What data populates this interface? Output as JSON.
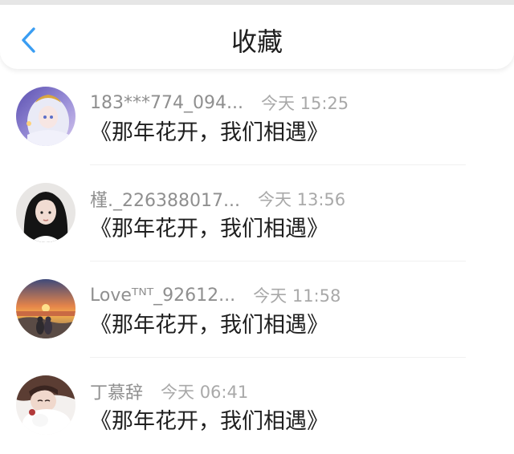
{
  "header": {
    "title": "收藏",
    "back_icon": "chevron-left-icon",
    "accent_color": "#3a9df2"
  },
  "favorites": [
    {
      "username": "183***774_094...",
      "time": "今天 15:25",
      "message": "《那年花开，我们相遇》",
      "avatar": "anime-character-avatar"
    },
    {
      "username": "槿._226388017...",
      "time": "今天 13:56",
      "message": "《那年花开，我们相遇》",
      "avatar": "girl-portrait-avatar"
    },
    {
      "username": "Loveᵀᴺᵀ_92612...",
      "time": "今天 11:58",
      "message": "《那年花开，我们相遇》",
      "avatar": "sunset-beach-avatar"
    },
    {
      "username": "丁慕辞",
      "time": "今天 06:41",
      "message": "《那年花开，我们相遇》",
      "avatar": "girl-with-cat-avatar"
    }
  ]
}
